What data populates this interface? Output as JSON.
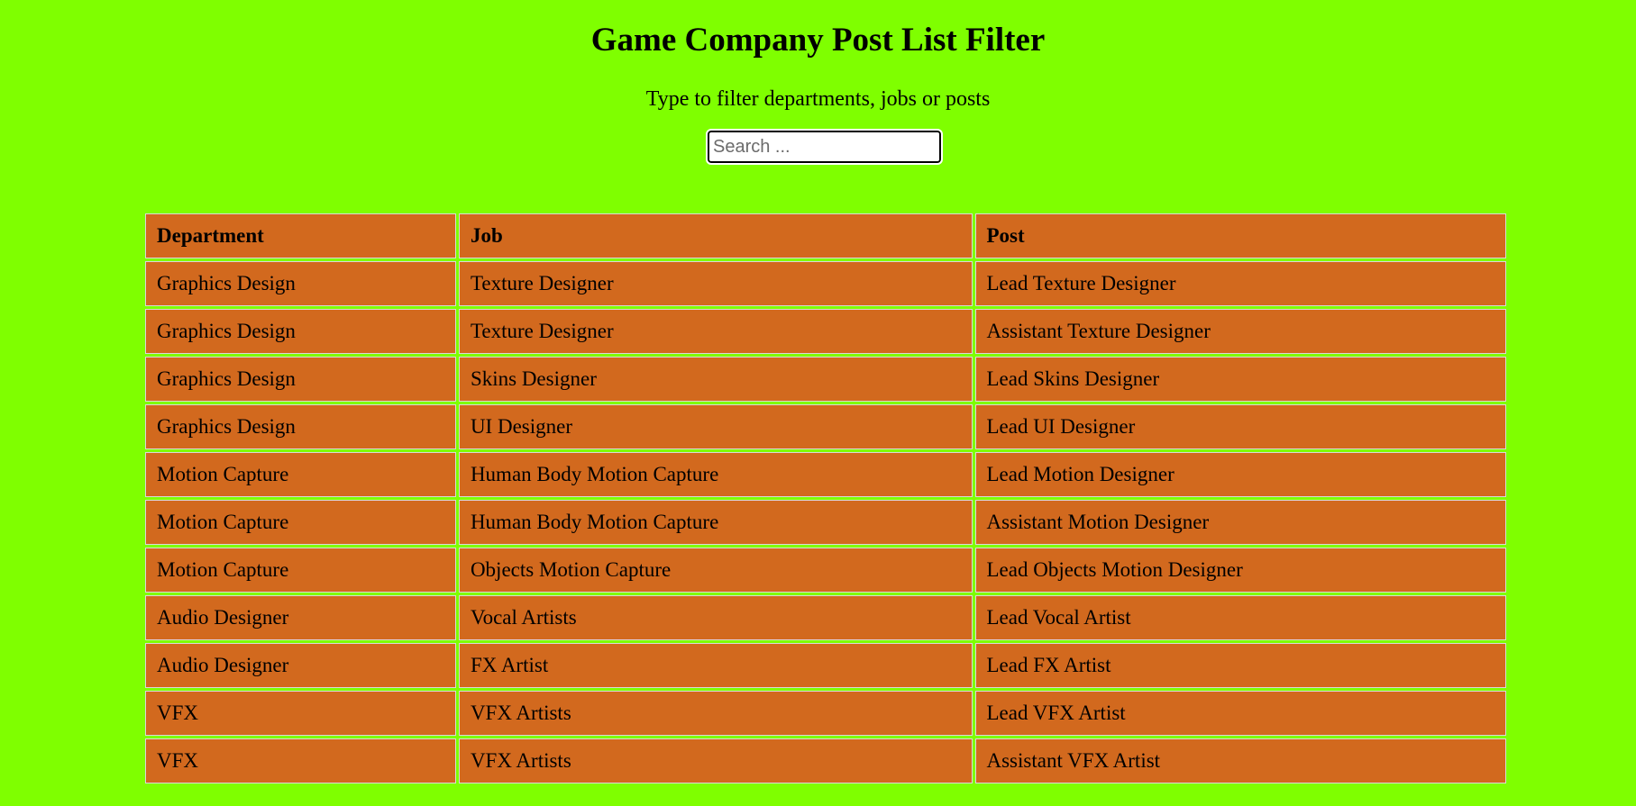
{
  "page": {
    "title": "Game Company Post List Filter",
    "subtitle": "Type to filter departments, jobs or posts"
  },
  "search": {
    "placeholder": "Search ...",
    "value": ""
  },
  "table": {
    "headers": [
      "Department",
      "Job",
      "Post"
    ],
    "rows": [
      [
        "Graphics Design",
        "Texture Designer",
        "Lead Texture Designer"
      ],
      [
        "Graphics Design",
        "Texture Designer",
        "Assistant Texture Designer"
      ],
      [
        "Graphics Design",
        "Skins Designer",
        "Lead Skins Designer"
      ],
      [
        "Graphics Design",
        "UI Designer",
        "Lead UI Designer"
      ],
      [
        "Motion Capture",
        "Human Body Motion Capture",
        "Lead Motion Designer"
      ],
      [
        "Motion Capture",
        "Human Body Motion Capture",
        "Assistant Motion Designer"
      ],
      [
        "Motion Capture",
        "Objects Motion Capture",
        "Lead Objects Motion Designer"
      ],
      [
        "Audio Designer",
        "Vocal Artists",
        "Lead Vocal Artist"
      ],
      [
        "Audio Designer",
        "FX Artist",
        "Lead FX Artist"
      ],
      [
        "VFX",
        "VFX Artists",
        "Lead VFX Artist"
      ],
      [
        "VFX",
        "VFX Artists",
        "Assistant VFX Artist"
      ]
    ]
  },
  "colors": {
    "background": "#7fff00",
    "cell": "#d2691e"
  }
}
